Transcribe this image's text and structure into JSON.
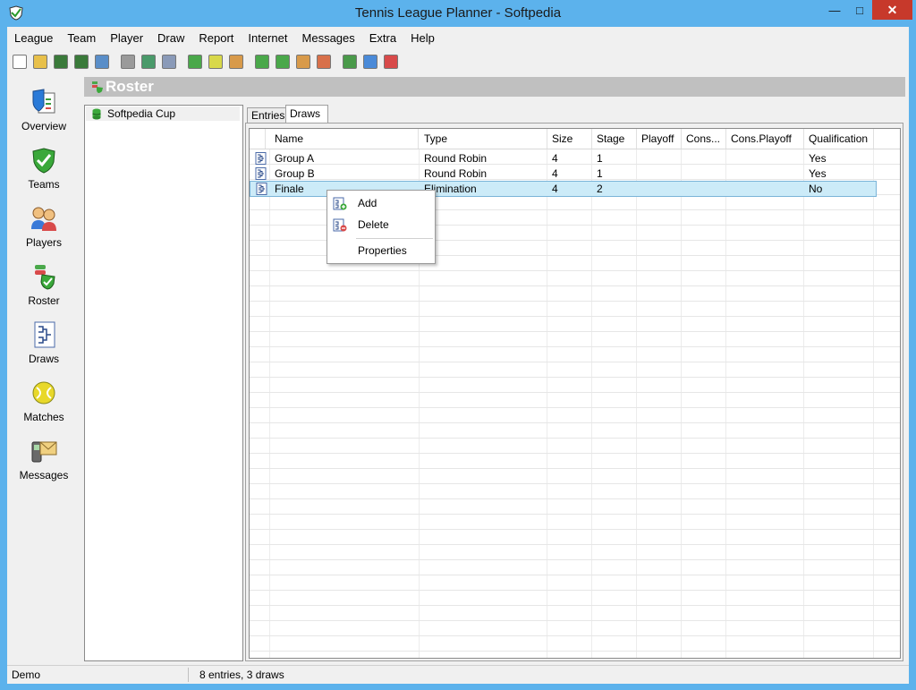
{
  "window": {
    "title": "Tennis League Planner - Softpedia"
  },
  "menu": [
    {
      "label": "League",
      "icon": "league"
    },
    {
      "label": "Team",
      "icon": "team"
    },
    {
      "label": "Player",
      "icon": "player"
    },
    {
      "label": "Draw",
      "icon": "draw"
    },
    {
      "label": "Report",
      "icon": "report"
    },
    {
      "label": "Internet",
      "icon": "internet"
    },
    {
      "label": "Messages",
      "icon": "messages"
    },
    {
      "label": "Extra",
      "icon": "extra"
    },
    {
      "label": "Help",
      "icon": "help"
    }
  ],
  "toolbar": [
    {
      "name": "new-file",
      "color": "#ffffff"
    },
    {
      "name": "open-folder",
      "color": "#e8c04a"
    },
    {
      "name": "save",
      "color": "#3a7a3a"
    },
    {
      "name": "save-all",
      "color": "#3a7a3a"
    },
    {
      "name": "properties",
      "color": "#5a8ec8"
    },
    {
      "name": "print",
      "color": "#9a9a9a"
    },
    {
      "name": "web",
      "color": "#4a9a6a"
    },
    {
      "name": "email",
      "color": "#8a9ab8"
    },
    {
      "name": "team-shield",
      "color": "#4aa84a"
    },
    {
      "name": "ball",
      "color": "#d8d84a"
    },
    {
      "name": "player",
      "color": "#d89a4a"
    },
    {
      "name": "team-add",
      "color": "#4aa84a"
    },
    {
      "name": "team-edit",
      "color": "#4aa84a"
    },
    {
      "name": "player-add",
      "color": "#d89a4a"
    },
    {
      "name": "player-edit",
      "color": "#d8704a"
    },
    {
      "name": "roster",
      "color": "#4a9a4a"
    },
    {
      "name": "draw-add",
      "color": "#4a8ad8"
    },
    {
      "name": "draw-delete",
      "color": "#d84a4a"
    }
  ],
  "nav": [
    {
      "label": "Overview",
      "icon": "overview"
    },
    {
      "label": "Teams",
      "icon": "teams"
    },
    {
      "label": "Players",
      "icon": "players"
    },
    {
      "label": "Roster",
      "icon": "roster"
    },
    {
      "label": "Draws",
      "icon": "draws"
    },
    {
      "label": "Matches",
      "icon": "matches"
    },
    {
      "label": "Messages",
      "icon": "messages"
    }
  ],
  "section": {
    "title": "Roster"
  },
  "tree": {
    "items": [
      {
        "label": "Softpedia Cup",
        "icon": "database-icon"
      }
    ]
  },
  "tabs": [
    {
      "label": "Entries",
      "active": false
    },
    {
      "label": "Draws",
      "active": true
    }
  ],
  "grid": {
    "columns": [
      "Name",
      "Type",
      "Size",
      "Stage",
      "Playoff",
      "Cons...",
      "Cons.Playoff",
      "Qualification"
    ],
    "rows": [
      {
        "name": "Group A",
        "type": "Round Robin",
        "size": "4",
        "stage": "1",
        "playoff": "",
        "cons": "",
        "cons_playoff": "",
        "qualification": "Yes",
        "selected": false
      },
      {
        "name": "Group B",
        "type": "Round Robin",
        "size": "4",
        "stage": "1",
        "playoff": "",
        "cons": "",
        "cons_playoff": "",
        "qualification": "Yes",
        "selected": false
      },
      {
        "name": "Finale",
        "type": "Elimination",
        "size": "4",
        "stage": "2",
        "playoff": "",
        "cons": "",
        "cons_playoff": "",
        "qualification": "No",
        "selected": true
      }
    ]
  },
  "context_menu": {
    "items": [
      {
        "label": "Add",
        "icon": "add-icon"
      },
      {
        "label": "Delete",
        "icon": "delete-icon"
      },
      {
        "label": "Properties",
        "icon": ""
      }
    ]
  },
  "status": {
    "left": "Demo",
    "right": "8 entries, 3 draws"
  },
  "colors": {
    "titlebar": "#5cb2ec",
    "close": "#c7392b",
    "selection": "#ccebf8",
    "header": "#c0c0c0"
  }
}
